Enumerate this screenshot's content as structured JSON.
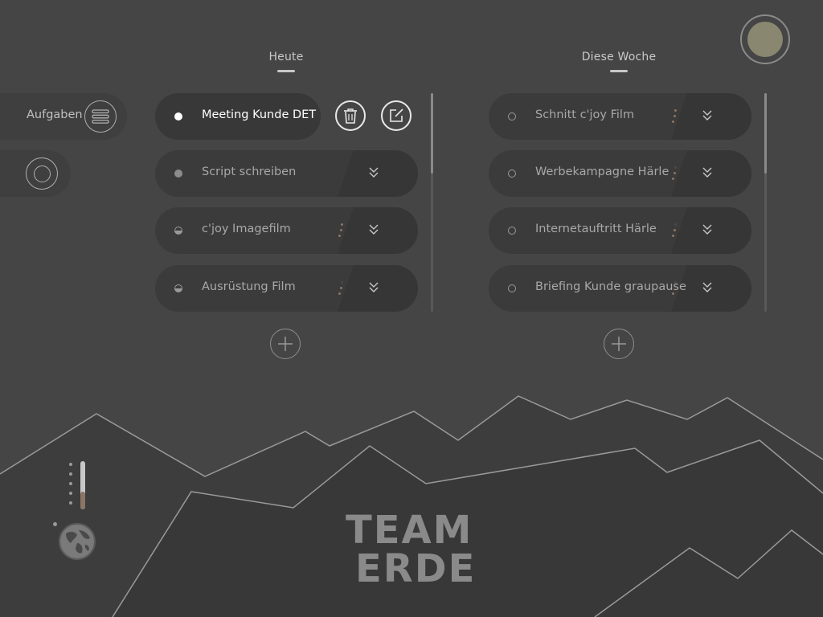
{
  "columns": {
    "today": {
      "title": "Heute",
      "items": [
        {
          "label": "Meeting Kunde DET",
          "status": "active"
        },
        {
          "label": "Script schreiben",
          "status": "filled"
        },
        {
          "label": "c'joy Imagefilm",
          "status": "half"
        },
        {
          "label": "Ausrüstung Film",
          "status": "half"
        }
      ]
    },
    "week": {
      "title": "Diese Woche",
      "items": [
        {
          "label": "Schnitt c'joy Film",
          "status": "open"
        },
        {
          "label": "Werbekampagne Härle",
          "status": "open"
        },
        {
          "label": "Internetauftritt Härle",
          "status": "open"
        },
        {
          "label": "Briefing Kunde graupause",
          "status": "open"
        }
      ]
    }
  },
  "sidebar": {
    "menu_label": "Aufgaben",
    "menu_icon": "hamburger-icon",
    "second_icon": "target-icon"
  },
  "actions": {
    "delete_icon": "trash-icon",
    "edit_icon": "edit-icon"
  },
  "brand": {
    "line1": "TEAM",
    "line2": "ERDE"
  },
  "colors": {
    "background": "#454545",
    "pill": "#3b3b3b",
    "accent_profile": "#8a8770",
    "dots_accent": "#8a7566"
  }
}
